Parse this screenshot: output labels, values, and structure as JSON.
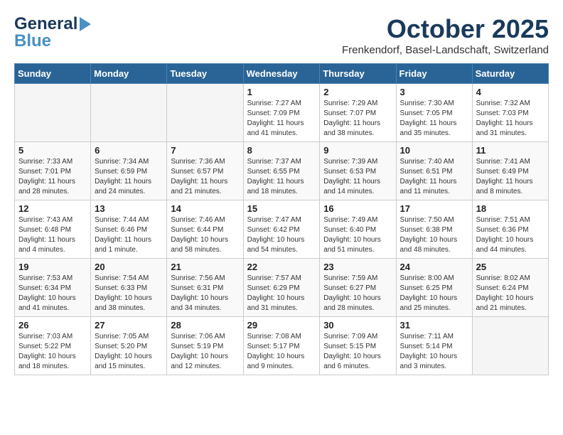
{
  "header": {
    "logo_general": "General",
    "logo_blue": "Blue",
    "month": "October 2025",
    "location": "Frenkendorf, Basel-Landschaft, Switzerland"
  },
  "weekdays": [
    "Sunday",
    "Monday",
    "Tuesday",
    "Wednesday",
    "Thursday",
    "Friday",
    "Saturday"
  ],
  "weeks": [
    [
      {
        "day": "",
        "info": ""
      },
      {
        "day": "",
        "info": ""
      },
      {
        "day": "",
        "info": ""
      },
      {
        "day": "1",
        "info": "Sunrise: 7:27 AM\nSunset: 7:09 PM\nDaylight: 11 hours\nand 41 minutes."
      },
      {
        "day": "2",
        "info": "Sunrise: 7:29 AM\nSunset: 7:07 PM\nDaylight: 11 hours\nand 38 minutes."
      },
      {
        "day": "3",
        "info": "Sunrise: 7:30 AM\nSunset: 7:05 PM\nDaylight: 11 hours\nand 35 minutes."
      },
      {
        "day": "4",
        "info": "Sunrise: 7:32 AM\nSunset: 7:03 PM\nDaylight: 11 hours\nand 31 minutes."
      }
    ],
    [
      {
        "day": "5",
        "info": "Sunrise: 7:33 AM\nSunset: 7:01 PM\nDaylight: 11 hours\nand 28 minutes."
      },
      {
        "day": "6",
        "info": "Sunrise: 7:34 AM\nSunset: 6:59 PM\nDaylight: 11 hours\nand 24 minutes."
      },
      {
        "day": "7",
        "info": "Sunrise: 7:36 AM\nSunset: 6:57 PM\nDaylight: 11 hours\nand 21 minutes."
      },
      {
        "day": "8",
        "info": "Sunrise: 7:37 AM\nSunset: 6:55 PM\nDaylight: 11 hours\nand 18 minutes."
      },
      {
        "day": "9",
        "info": "Sunrise: 7:39 AM\nSunset: 6:53 PM\nDaylight: 11 hours\nand 14 minutes."
      },
      {
        "day": "10",
        "info": "Sunrise: 7:40 AM\nSunset: 6:51 PM\nDaylight: 11 hours\nand 11 minutes."
      },
      {
        "day": "11",
        "info": "Sunrise: 7:41 AM\nSunset: 6:49 PM\nDaylight: 11 hours\nand 8 minutes."
      }
    ],
    [
      {
        "day": "12",
        "info": "Sunrise: 7:43 AM\nSunset: 6:48 PM\nDaylight: 11 hours\nand 4 minutes."
      },
      {
        "day": "13",
        "info": "Sunrise: 7:44 AM\nSunset: 6:46 PM\nDaylight: 11 hours\nand 1 minute."
      },
      {
        "day": "14",
        "info": "Sunrise: 7:46 AM\nSunset: 6:44 PM\nDaylight: 10 hours\nand 58 minutes."
      },
      {
        "day": "15",
        "info": "Sunrise: 7:47 AM\nSunset: 6:42 PM\nDaylight: 10 hours\nand 54 minutes."
      },
      {
        "day": "16",
        "info": "Sunrise: 7:49 AM\nSunset: 6:40 PM\nDaylight: 10 hours\nand 51 minutes."
      },
      {
        "day": "17",
        "info": "Sunrise: 7:50 AM\nSunset: 6:38 PM\nDaylight: 10 hours\nand 48 minutes."
      },
      {
        "day": "18",
        "info": "Sunrise: 7:51 AM\nSunset: 6:36 PM\nDaylight: 10 hours\nand 44 minutes."
      }
    ],
    [
      {
        "day": "19",
        "info": "Sunrise: 7:53 AM\nSunset: 6:34 PM\nDaylight: 10 hours\nand 41 minutes."
      },
      {
        "day": "20",
        "info": "Sunrise: 7:54 AM\nSunset: 6:33 PM\nDaylight: 10 hours\nand 38 minutes."
      },
      {
        "day": "21",
        "info": "Sunrise: 7:56 AM\nSunset: 6:31 PM\nDaylight: 10 hours\nand 34 minutes."
      },
      {
        "day": "22",
        "info": "Sunrise: 7:57 AM\nSunset: 6:29 PM\nDaylight: 10 hours\nand 31 minutes."
      },
      {
        "day": "23",
        "info": "Sunrise: 7:59 AM\nSunset: 6:27 PM\nDaylight: 10 hours\nand 28 minutes."
      },
      {
        "day": "24",
        "info": "Sunrise: 8:00 AM\nSunset: 6:25 PM\nDaylight: 10 hours\nand 25 minutes."
      },
      {
        "day": "25",
        "info": "Sunrise: 8:02 AM\nSunset: 6:24 PM\nDaylight: 10 hours\nand 21 minutes."
      }
    ],
    [
      {
        "day": "26",
        "info": "Sunrise: 7:03 AM\nSunset: 5:22 PM\nDaylight: 10 hours\nand 18 minutes."
      },
      {
        "day": "27",
        "info": "Sunrise: 7:05 AM\nSunset: 5:20 PM\nDaylight: 10 hours\nand 15 minutes."
      },
      {
        "day": "28",
        "info": "Sunrise: 7:06 AM\nSunset: 5:19 PM\nDaylight: 10 hours\nand 12 minutes."
      },
      {
        "day": "29",
        "info": "Sunrise: 7:08 AM\nSunset: 5:17 PM\nDaylight: 10 hours\nand 9 minutes."
      },
      {
        "day": "30",
        "info": "Sunrise: 7:09 AM\nSunset: 5:15 PM\nDaylight: 10 hours\nand 6 minutes."
      },
      {
        "day": "31",
        "info": "Sunrise: 7:11 AM\nSunset: 5:14 PM\nDaylight: 10 hours\nand 3 minutes."
      },
      {
        "day": "",
        "info": ""
      }
    ]
  ]
}
